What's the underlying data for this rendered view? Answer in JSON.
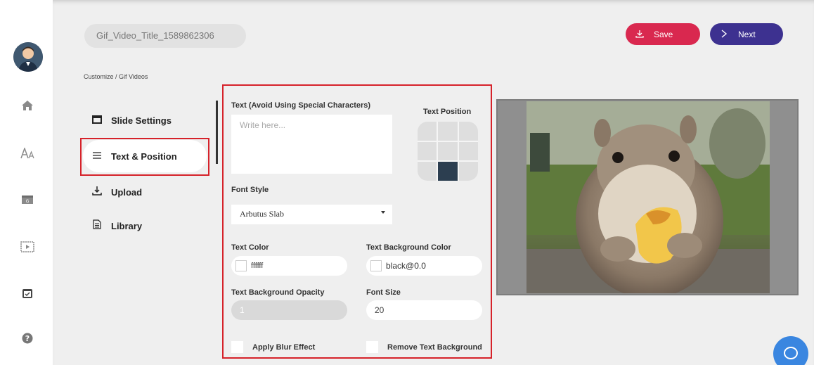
{
  "header": {
    "video_title": "Gif_Video_Title_1589862306",
    "save_label": "Save",
    "next_label": "Next"
  },
  "breadcrumb": "Customize  /  Gif Videos",
  "rail": {
    "icons": [
      "home-icon",
      "font-icon",
      "gif-icon",
      "video-icon",
      "calendar-icon",
      "help-icon"
    ]
  },
  "menu": {
    "items": [
      {
        "label": "Slide Settings",
        "icon": "slide-icon"
      },
      {
        "label": "Text & Position",
        "icon": "menu-lines-icon"
      },
      {
        "label": "Upload",
        "icon": "upload-icon"
      },
      {
        "label": "Library",
        "icon": "document-icon"
      }
    ],
    "active_index": 1
  },
  "panel": {
    "text_label": "Text (Avoid Using Special Characters)",
    "text_placeholder": "Write here...",
    "position_label": "Text Position",
    "selected_position": "bottom-center",
    "font_style_label": "Font Style",
    "font_style_value": "Arbutus Slab",
    "text_color_label": "Text Color",
    "text_color_value": "ffffff",
    "bg_color_label": "Text Background Color",
    "bg_color_value": "black@0.0",
    "opacity_label": "Text Background Opacity",
    "opacity_value": "1",
    "font_size_label": "Font Size",
    "font_size_value": "20",
    "blur_label": "Apply Blur Effect",
    "remove_bg_label": "Remove Text Background"
  },
  "colors": {
    "save": "#d9284f",
    "next": "#3d3190",
    "highlight": "#d6222a",
    "chat": "#3a86e0"
  }
}
